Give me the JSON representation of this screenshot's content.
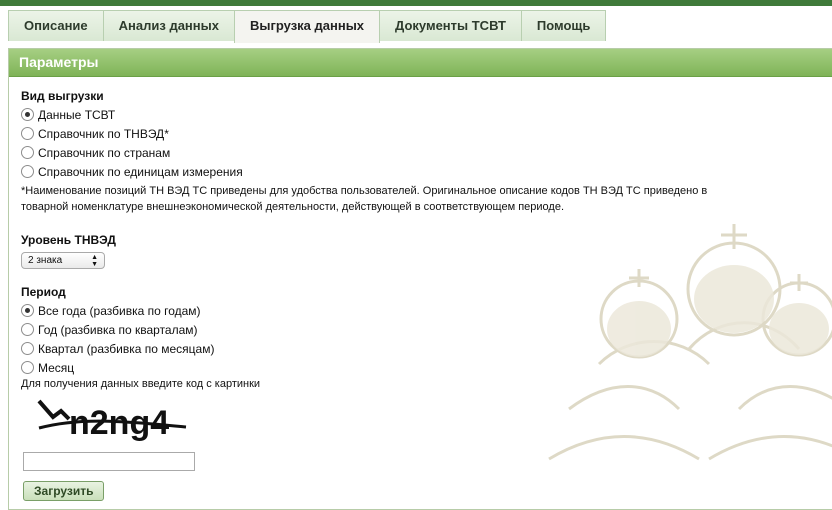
{
  "tabs": [
    {
      "label": "Описание"
    },
    {
      "label": "Анализ данных"
    },
    {
      "label": "Выгрузка данных",
      "active": true
    },
    {
      "label": "Документы ТСВТ"
    },
    {
      "label": "Помощь"
    }
  ],
  "panel": {
    "title": "Параметры",
    "export_type": {
      "label": "Вид выгрузки",
      "options": [
        "Данные ТСВТ",
        "Справочник по ТНВЭД*",
        "Справочник по странам",
        "Справочник по единицам измерения"
      ],
      "selected_index": 0
    },
    "note": "*Наименование позиций ТН ВЭД ТС приведены для удобства пользователей. Оригинальное описание кодов ТН ВЭД ТС приведено в товарной номенклатуре внешнеэкономической деятельности, действующей в соответствующем периоде.",
    "level": {
      "label": "Уровень ТНВЭД",
      "selected": "2 знака"
    },
    "period": {
      "label": "Период",
      "options": [
        "Все года (разбивка по годам)",
        "Год (разбивка по кварталам)",
        "Квартал (разбивка по месяцам)",
        "Месяц"
      ],
      "selected_index": 0
    },
    "captcha": {
      "label": "Для получения данных введите код с картинки",
      "text": "n2ng4",
      "input_value": ""
    },
    "submit_label": "Загрузить"
  },
  "colors": {
    "header_green": "#7fb357",
    "top_line": "#3f7a3a"
  }
}
